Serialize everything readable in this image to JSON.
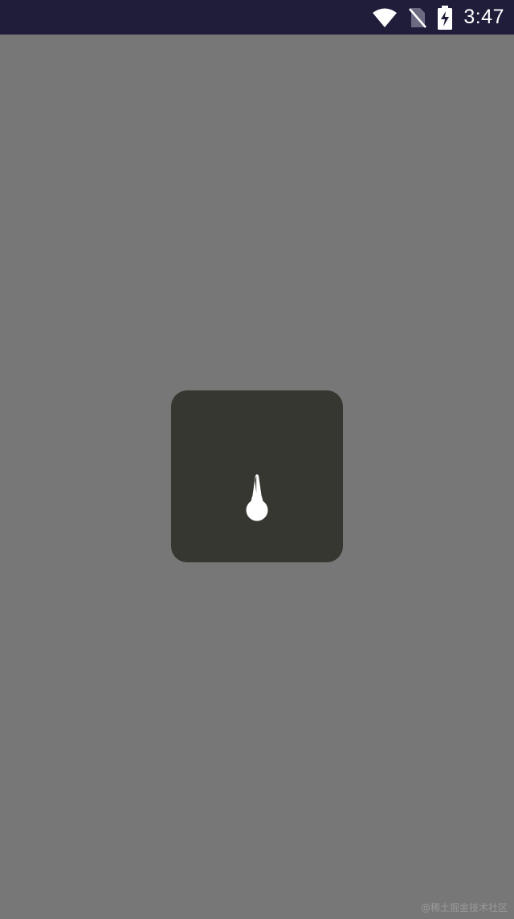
{
  "status_bar": {
    "time": "3:47",
    "icons": [
      "wifi-icon",
      "no-sim-icon",
      "battery-charging-icon"
    ],
    "background_color": "#201d3a"
  },
  "screen": {
    "background_color": "#777777"
  },
  "loading_dialog": {
    "background_color": "#373731",
    "spinner_icon": "loading-needle-icon",
    "spinner_color": "#ffffff"
  },
  "watermark": {
    "text": "@稀土掘金技术社区"
  }
}
